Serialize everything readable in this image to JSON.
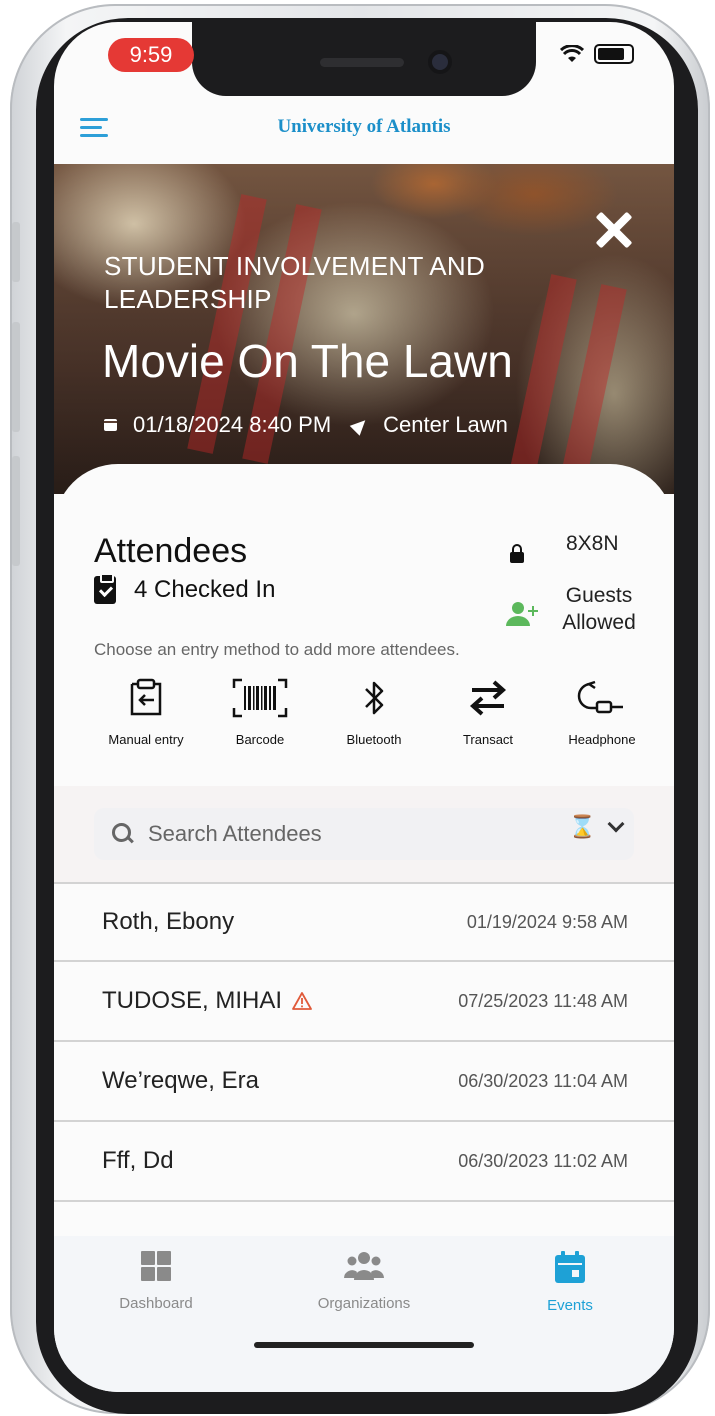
{
  "status_bar": {
    "time": "9:59"
  },
  "header": {
    "brand": "University of Atlantis"
  },
  "event": {
    "organization": "STUDENT INVOLVEMENT AND LEADERSHIP",
    "title": "Movie On The Lawn",
    "datetime": "01/18/2024 8:40 PM",
    "location": "Center Lawn"
  },
  "attendees": {
    "heading": "Attendees",
    "checked_in": "4 Checked In",
    "hint": "Choose an entry method to add more attendees.",
    "code": "8X8N",
    "guests": "Guests Allowed"
  },
  "methods": [
    {
      "label": "Manual entry",
      "icon": "manual-entry-icon"
    },
    {
      "label": "Barcode",
      "icon": "barcode-icon"
    },
    {
      "label": "Bluetooth",
      "icon": "bluetooth-icon"
    },
    {
      "label": "Transact",
      "icon": "transact-icon"
    },
    {
      "label": "Headphone",
      "icon": "headphone-icon"
    }
  ],
  "search": {
    "placeholder": "Search Attendees"
  },
  "list": [
    {
      "name": "Roth, Ebony",
      "time": "01/19/2024 9:58 AM",
      "warning": false
    },
    {
      "name": "TUDOSE, MIHAI",
      "time": "07/25/2023 11:48 AM",
      "warning": true
    },
    {
      "name": "We’reqwe, Era",
      "time": "06/30/2023 11:04 AM",
      "warning": false
    },
    {
      "name": "Fff, Dd",
      "time": "06/30/2023 11:02 AM",
      "warning": false
    }
  ],
  "tabs": [
    {
      "label": "Dashboard",
      "active": false
    },
    {
      "label": "Organizations",
      "active": false
    },
    {
      "label": "Events",
      "active": true
    }
  ],
  "colors": {
    "accent": "#1ea1d6",
    "brand": "#1b8fc9",
    "warning": "#e05a3a",
    "guest_icon": "#5cb85c",
    "time_pill": "#e53935"
  }
}
